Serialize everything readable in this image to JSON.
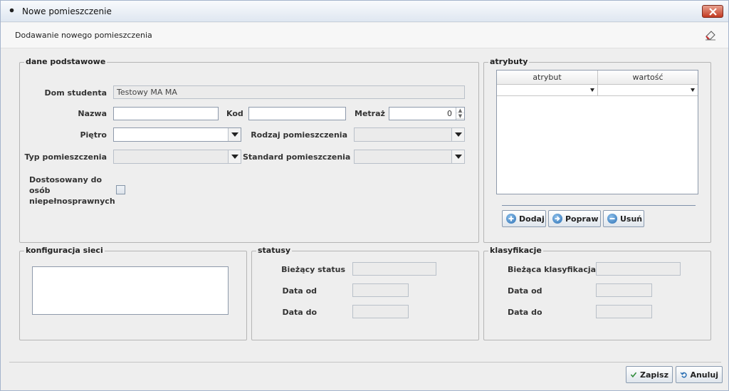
{
  "window": {
    "title": "Nowe pomieszczenie"
  },
  "header": {
    "title": "Dodawanie nowego pomieszczenia"
  },
  "basic": {
    "legend": "dane podstawowe",
    "dom_label": "Dom studenta",
    "dom_value": "Testowy MA MA",
    "nazwa_label": "Nazwa",
    "kod_label": "Kod",
    "metraz_label": "Metraż",
    "metraz_value": "0",
    "pietro_label": "Piętro",
    "rodzaj_label": "Rodzaj pomieszczenia",
    "typ_label": "Typ pomieszczenia",
    "standard_label": "Standard pomieszczenia",
    "dostosowany_line1": "Dostosowany do",
    "dostosowany_line2": "osób",
    "dostosowany_line3": "niepełnosprawnych"
  },
  "attributes": {
    "legend": "atrybuty",
    "columns": [
      "atrybut",
      "wartość"
    ],
    "add_label": "Dodaj",
    "edit_label": "Popraw",
    "remove_label": "Usuń"
  },
  "network": {
    "legend": "konfiguracja sieci"
  },
  "statuses": {
    "legend": "statusy",
    "current_label": "Bieżący status",
    "from_label": "Data od",
    "to_label": "Data do"
  },
  "classifications": {
    "legend": "klasyfikacje",
    "current_label": "Bieżąca klasyfikacja",
    "from_label": "Data od",
    "to_label": "Data do"
  },
  "footer": {
    "save_label": "Zapisz",
    "cancel_label": "Anuluj"
  },
  "colors": {
    "accent": "#2a6fb3",
    "close": "#c23a22",
    "save_check": "#2e8b3a"
  }
}
